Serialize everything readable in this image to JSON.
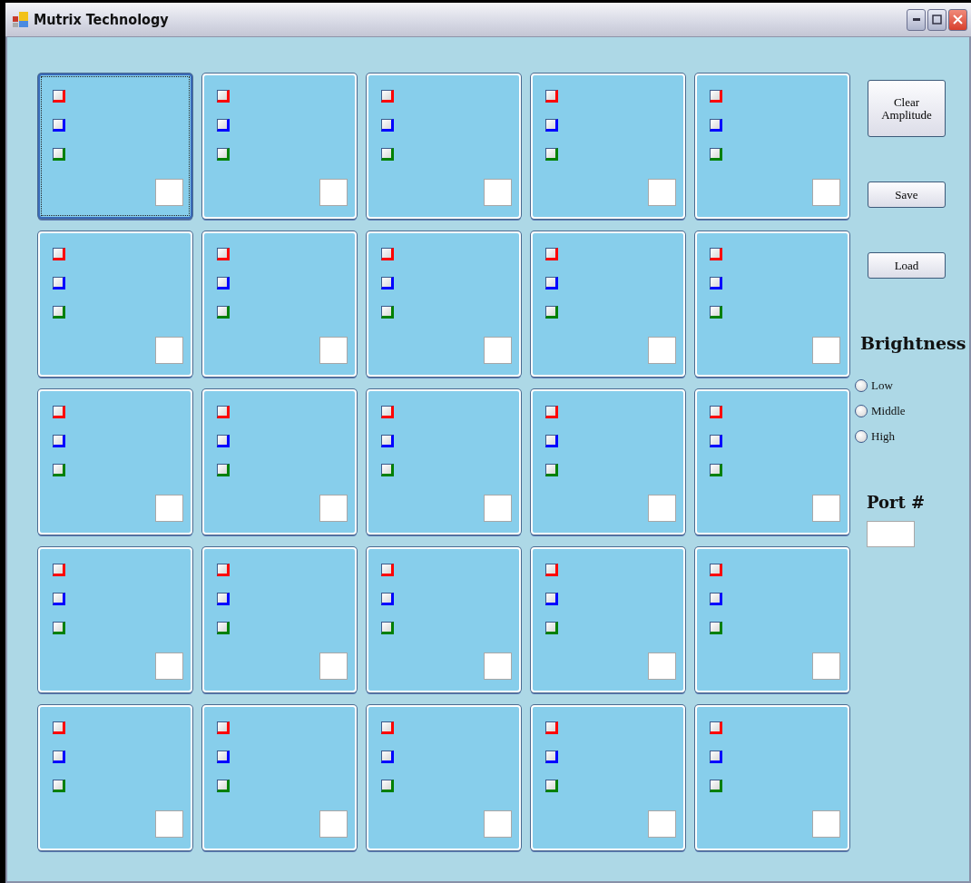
{
  "window": {
    "title": "Mutrix Technology"
  },
  "cells": [
    {
      "focused": true,
      "checkboxes": [
        {
          "color": "#ff0000",
          "checked": false
        },
        {
          "color": "#0000ff",
          "checked": false
        },
        {
          "color": "#008000",
          "checked": false
        }
      ]
    },
    {
      "focused": false,
      "checkboxes": [
        {
          "color": "#ff0000",
          "checked": false
        },
        {
          "color": "#0000ff",
          "checked": false
        },
        {
          "color": "#008000",
          "checked": false
        }
      ]
    },
    {
      "focused": false,
      "checkboxes": [
        {
          "color": "#ff0000",
          "checked": false
        },
        {
          "color": "#0000ff",
          "checked": false
        },
        {
          "color": "#008000",
          "checked": false
        }
      ]
    },
    {
      "focused": false,
      "checkboxes": [
        {
          "color": "#ff0000",
          "checked": false
        },
        {
          "color": "#0000ff",
          "checked": false
        },
        {
          "color": "#008000",
          "checked": false
        }
      ]
    },
    {
      "focused": false,
      "checkboxes": [
        {
          "color": "#ff0000",
          "checked": false
        },
        {
          "color": "#0000ff",
          "checked": false
        },
        {
          "color": "#008000",
          "checked": false
        }
      ]
    },
    {
      "focused": false,
      "checkboxes": [
        {
          "color": "#ff0000",
          "checked": false
        },
        {
          "color": "#0000ff",
          "checked": false
        },
        {
          "color": "#008000",
          "checked": false
        }
      ]
    },
    {
      "focused": false,
      "checkboxes": [
        {
          "color": "#ff0000",
          "checked": false
        },
        {
          "color": "#0000ff",
          "checked": false
        },
        {
          "color": "#008000",
          "checked": false
        }
      ]
    },
    {
      "focused": false,
      "checkboxes": [
        {
          "color": "#ff0000",
          "checked": false
        },
        {
          "color": "#0000ff",
          "checked": false
        },
        {
          "color": "#008000",
          "checked": false
        }
      ]
    },
    {
      "focused": false,
      "checkboxes": [
        {
          "color": "#ff0000",
          "checked": false
        },
        {
          "color": "#0000ff",
          "checked": false
        },
        {
          "color": "#008000",
          "checked": false
        }
      ]
    },
    {
      "focused": false,
      "checkboxes": [
        {
          "color": "#ff0000",
          "checked": false
        },
        {
          "color": "#0000ff",
          "checked": false
        },
        {
          "color": "#008000",
          "checked": false
        }
      ]
    },
    {
      "focused": false,
      "checkboxes": [
        {
          "color": "#ff0000",
          "checked": false
        },
        {
          "color": "#0000ff",
          "checked": false
        },
        {
          "color": "#008000",
          "checked": false
        }
      ]
    },
    {
      "focused": false,
      "checkboxes": [
        {
          "color": "#ff0000",
          "checked": false
        },
        {
          "color": "#0000ff",
          "checked": false
        },
        {
          "color": "#008000",
          "checked": false
        }
      ]
    },
    {
      "focused": false,
      "checkboxes": [
        {
          "color": "#ff0000",
          "checked": false
        },
        {
          "color": "#0000ff",
          "checked": false
        },
        {
          "color": "#008000",
          "checked": false
        }
      ]
    },
    {
      "focused": false,
      "checkboxes": [
        {
          "color": "#ff0000",
          "checked": false
        },
        {
          "color": "#0000ff",
          "checked": false
        },
        {
          "color": "#008000",
          "checked": false
        }
      ]
    },
    {
      "focused": false,
      "checkboxes": [
        {
          "color": "#ff0000",
          "checked": false
        },
        {
          "color": "#0000ff",
          "checked": false
        },
        {
          "color": "#008000",
          "checked": false
        }
      ]
    },
    {
      "focused": false,
      "checkboxes": [
        {
          "color": "#ff0000",
          "checked": false
        },
        {
          "color": "#0000ff",
          "checked": false
        },
        {
          "color": "#008000",
          "checked": false
        }
      ]
    },
    {
      "focused": false,
      "checkboxes": [
        {
          "color": "#ff0000",
          "checked": false
        },
        {
          "color": "#0000ff",
          "checked": false
        },
        {
          "color": "#008000",
          "checked": false
        }
      ]
    },
    {
      "focused": false,
      "checkboxes": [
        {
          "color": "#ff0000",
          "checked": false
        },
        {
          "color": "#0000ff",
          "checked": false
        },
        {
          "color": "#008000",
          "checked": false
        }
      ]
    },
    {
      "focused": false,
      "checkboxes": [
        {
          "color": "#ff0000",
          "checked": false
        },
        {
          "color": "#0000ff",
          "checked": false
        },
        {
          "color": "#008000",
          "checked": false
        }
      ]
    },
    {
      "focused": false,
      "checkboxes": [
        {
          "color": "#ff0000",
          "checked": false
        },
        {
          "color": "#0000ff",
          "checked": false
        },
        {
          "color": "#008000",
          "checked": false
        }
      ]
    },
    {
      "focused": false,
      "checkboxes": [
        {
          "color": "#ff0000",
          "checked": false
        },
        {
          "color": "#0000ff",
          "checked": false
        },
        {
          "color": "#008000",
          "checked": false
        }
      ]
    },
    {
      "focused": false,
      "checkboxes": [
        {
          "color": "#ff0000",
          "checked": false
        },
        {
          "color": "#0000ff",
          "checked": false
        },
        {
          "color": "#008000",
          "checked": false
        }
      ]
    },
    {
      "focused": false,
      "checkboxes": [
        {
          "color": "#ff0000",
          "checked": false
        },
        {
          "color": "#0000ff",
          "checked": false
        },
        {
          "color": "#008000",
          "checked": false
        }
      ]
    },
    {
      "focused": false,
      "checkboxes": [
        {
          "color": "#ff0000",
          "checked": false
        },
        {
          "color": "#0000ff",
          "checked": false
        },
        {
          "color": "#008000",
          "checked": false
        }
      ]
    },
    {
      "focused": false,
      "checkboxes": [
        {
          "color": "#ff0000",
          "checked": false
        },
        {
          "color": "#0000ff",
          "checked": false
        },
        {
          "color": "#008000",
          "checked": false
        }
      ]
    }
  ],
  "buttons": [
    {
      "kind": "tall",
      "label": "Clear Amplitude"
    },
    {
      "kind": "short",
      "label": "Save"
    },
    {
      "kind": "short",
      "label": "Load"
    }
  ],
  "brightness": {
    "title": "Brightness",
    "options": [
      {
        "label": "Low",
        "selected": false
      },
      {
        "label": "Middle",
        "selected": false
      },
      {
        "label": "High",
        "selected": false
      }
    ]
  },
  "port": {
    "label": "Port #"
  }
}
